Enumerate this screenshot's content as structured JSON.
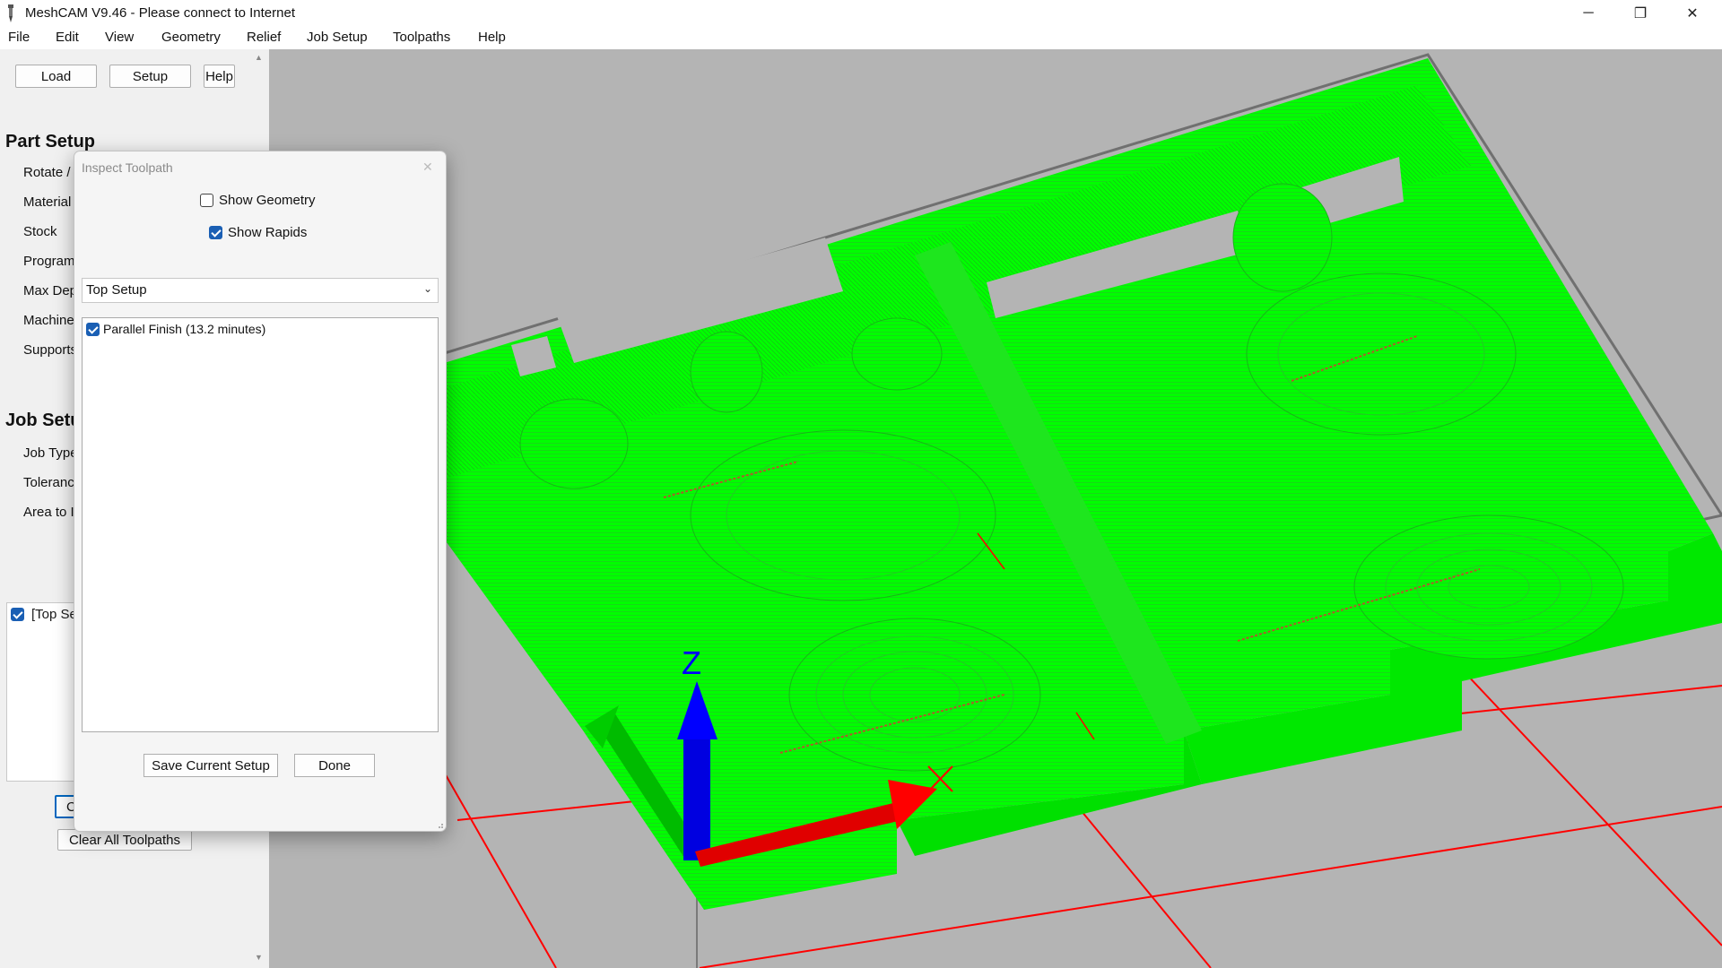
{
  "window": {
    "title": "MeshCAM V9.46 - Please connect to Internet",
    "minimize_glyph": "─",
    "restore_glyph": "❐",
    "close_glyph": "✕"
  },
  "menu": [
    "File",
    "Edit",
    "View",
    "Geometry",
    "Relief",
    "Job Setup",
    "Toolpaths",
    "Help"
  ],
  "toolbar": {
    "load": "Load",
    "setup": "Setup",
    "help": "Help"
  },
  "part_setup": {
    "title": "Part Setup",
    "items": [
      "Rotate /",
      "Material",
      "Stock",
      "Program",
      "Max Dep",
      "Machine",
      "Supports"
    ]
  },
  "job_setup": {
    "title": "Job Setu",
    "items": [
      "Job Type",
      "Toleranc",
      "Area to I"
    ]
  },
  "setup_list": {
    "item": "[Top Se",
    "checked": true
  },
  "buttons": {
    "calc_partial": "C",
    "clear_all": "Clear All Toolpaths"
  },
  "dialog": {
    "title": "Inspect Toolpath",
    "close": "✕",
    "show_geometry": {
      "label": "Show Geometry",
      "checked": false
    },
    "show_rapids": {
      "label": "Show Rapids",
      "checked": true
    },
    "setup_select": "Top Setup",
    "toolpaths": [
      {
        "label": "Parallel Finish (13.2 minutes)",
        "checked": true
      }
    ],
    "save_button": "Save Current Setup",
    "done_button": "Done"
  },
  "viewport": {
    "axis_label_z": "Z",
    "colors": {
      "background": "#b4b4b4",
      "toolpath": "#00ff00",
      "grid": "#ff0000",
      "x_axis": "#ff0000",
      "y_axis": "#00cc00",
      "z_axis": "#0000ff"
    }
  }
}
